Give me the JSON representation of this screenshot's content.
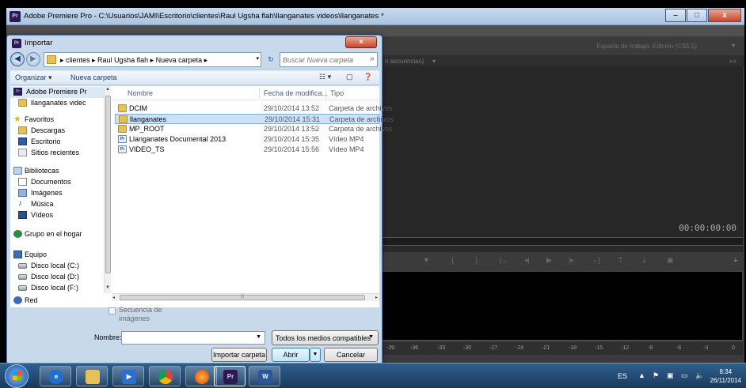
{
  "premiere": {
    "title": "Adobe Premiere Pro - C:\\Usuarios\\JAMI\\Escritorio\\clientes\\Raul Ugsha flah\\llanganates videos\\llanganates *",
    "workspace_label": "Espacio de trabajo:  Edición (CS5.5)",
    "tab_label": "n secuencias)",
    "timecode": "00:00:00:00",
    "meter_ticks": [
      "-39",
      "-36",
      "-33",
      "-30",
      "-27",
      "-24",
      "-21",
      "-18",
      "-15",
      "-12",
      "-9",
      "-6",
      "-3",
      "0"
    ]
  },
  "dialog": {
    "title": "Importar",
    "close_icon": "×",
    "breadcrumbs": "▸  clientes  ▸  Raul Ugsha flah  ▸  Nueva carpeta  ▸",
    "search_placeholder": "Buscar Nueva carpeta",
    "toolbar": {
      "organize": "Organizar ▾",
      "new_folder": "Nueva carpeta"
    },
    "nav": [
      {
        "label": "Adobe Premiere Pr",
        "icon": "premiere-icon"
      },
      {
        "label": "llanganates videc",
        "icon": "folder-icon"
      },
      {
        "label": "Favoritos",
        "icon": "star-icon"
      },
      {
        "label": "Descargas",
        "icon": "downloads-icon"
      },
      {
        "label": "Escritorio",
        "icon": "desktop-icon"
      },
      {
        "label": "Sitios recientes",
        "icon": "recent-icon"
      },
      {
        "label": "Bibliotecas",
        "icon": "library-icon"
      },
      {
        "label": "Documentos",
        "icon": "documents-icon"
      },
      {
        "label": "Imágenes",
        "icon": "images-icon"
      },
      {
        "label": "Música",
        "icon": "music-icon"
      },
      {
        "label": "Vídeos",
        "icon": "videos-icon"
      },
      {
        "label": "Grupo en el hogar",
        "icon": "homegroup-icon"
      },
      {
        "label": "Equipo",
        "icon": "computer-icon"
      },
      {
        "label": "Disco local (C:)",
        "icon": "drive-icon"
      },
      {
        "label": "Disco local (D:)",
        "icon": "drive-icon"
      },
      {
        "label": "Disco local (F:)",
        "icon": "drive-icon"
      },
      {
        "label": "Red",
        "icon": "network-icon"
      }
    ],
    "columns": {
      "name": "Nombre",
      "date": "Fecha de modifica...",
      "type": "Tipo"
    },
    "files": [
      {
        "name": "DCIM",
        "date": "29/10/2014 13:52",
        "type": "Carpeta de archivos",
        "icon": "folder-icon"
      },
      {
        "name": "llanganates",
        "date": "29/10/2014 15:31",
        "type": "Carpeta de archivos",
        "icon": "folder-icon"
      },
      {
        "name": "MP_ROOT",
        "date": "29/10/2014 13:52",
        "type": "Carpeta de archivos",
        "icon": "folder-icon"
      },
      {
        "name": "Llanganates Documental 2013",
        "date": "29/10/2014 15:35",
        "type": "Vídeo MP4",
        "icon": "video-file-icon"
      },
      {
        "name": "VIDEO_TS",
        "date": "29/10/2014 15:56",
        "type": "Vídeo MP4",
        "icon": "video-file-icon"
      }
    ],
    "selected_file": "llanganates",
    "sequence_check_label": "Secuencia de imágenes",
    "name_label": "Nombre:",
    "name_value": "",
    "type_filter": "Todos los medios compatibles",
    "buttons": {
      "import_folder": "Importar carpeta",
      "open": "Abrir",
      "cancel": "Cancelar"
    }
  },
  "taskbar": {
    "apps": [
      "ie-icon",
      "explorer-icon",
      "media-player-icon",
      "chrome-icon",
      "firefox-icon",
      "premiere-icon",
      "word-icon"
    ],
    "lang": "ES",
    "time": "8:34",
    "date": "26/11/2014"
  }
}
